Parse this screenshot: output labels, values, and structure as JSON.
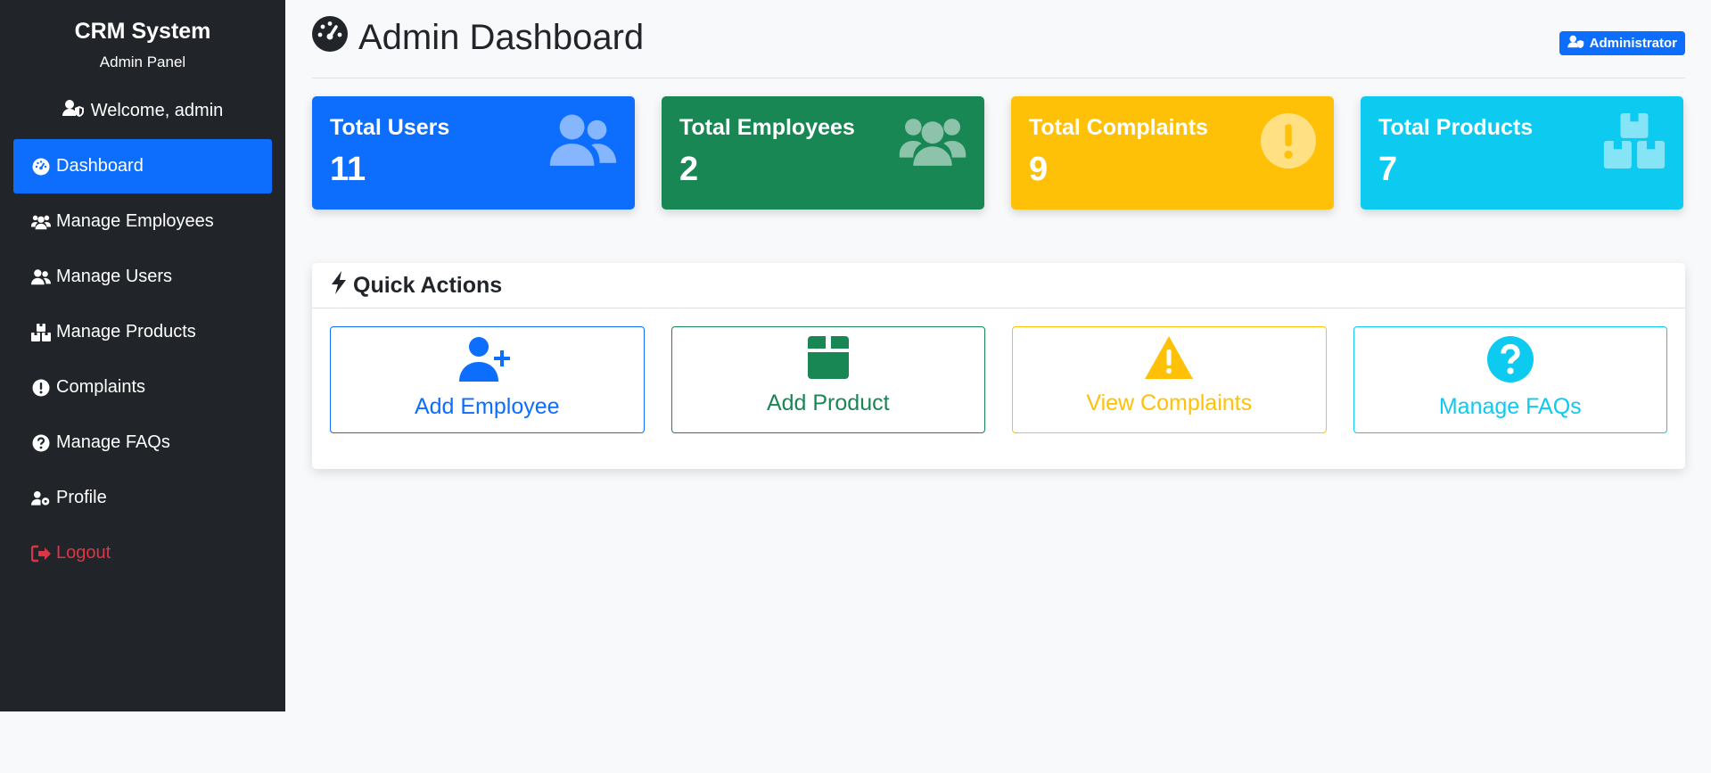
{
  "sidebar": {
    "brand_title": "CRM System",
    "brand_subtitle": "Admin Panel",
    "welcome": "Welcome, admin",
    "items": [
      {
        "label": "Dashboard",
        "icon": "tachometer-icon",
        "active": true
      },
      {
        "label": "Manage Employees",
        "icon": "users-icon"
      },
      {
        "label": "Manage Users",
        "icon": "user-friends-icon"
      },
      {
        "label": "Manage Products",
        "icon": "boxes-icon"
      },
      {
        "label": "Complaints",
        "icon": "exclamation-circle-icon"
      },
      {
        "label": "Manage FAQs",
        "icon": "question-circle-icon"
      },
      {
        "label": "Profile",
        "icon": "user-cog-icon"
      },
      {
        "label": "Logout",
        "icon": "sign-out-icon",
        "color": "#dc3545"
      }
    ]
  },
  "header": {
    "title": "Admin Dashboard",
    "role_badge": "Administrator"
  },
  "stats": [
    {
      "label": "Total Users",
      "value": "11",
      "color": "#0d6efd",
      "icon": "user-friends-icon"
    },
    {
      "label": "Total Employees",
      "value": "2",
      "color": "#198754",
      "icon": "users-icon"
    },
    {
      "label": "Total Complaints",
      "value": "9",
      "color": "#ffc107",
      "icon": "exclamation-circle-icon"
    },
    {
      "label": "Total Products",
      "value": "7",
      "color": "#0dcaf0",
      "icon": "boxes-icon"
    }
  ],
  "quick_actions": {
    "title": "Quick Actions",
    "buttons": [
      {
        "label": "Add Employee",
        "color": "#0d6efd",
        "icon": "user-plus-icon"
      },
      {
        "label": "Add Product",
        "color": "#198754",
        "icon": "box-icon"
      },
      {
        "label": "View Complaints",
        "color": "#ffc107",
        "icon": "warning-triangle-icon"
      },
      {
        "label": "Manage FAQs",
        "color": "#0dcaf0",
        "icon": "question-circle-icon"
      }
    ]
  }
}
